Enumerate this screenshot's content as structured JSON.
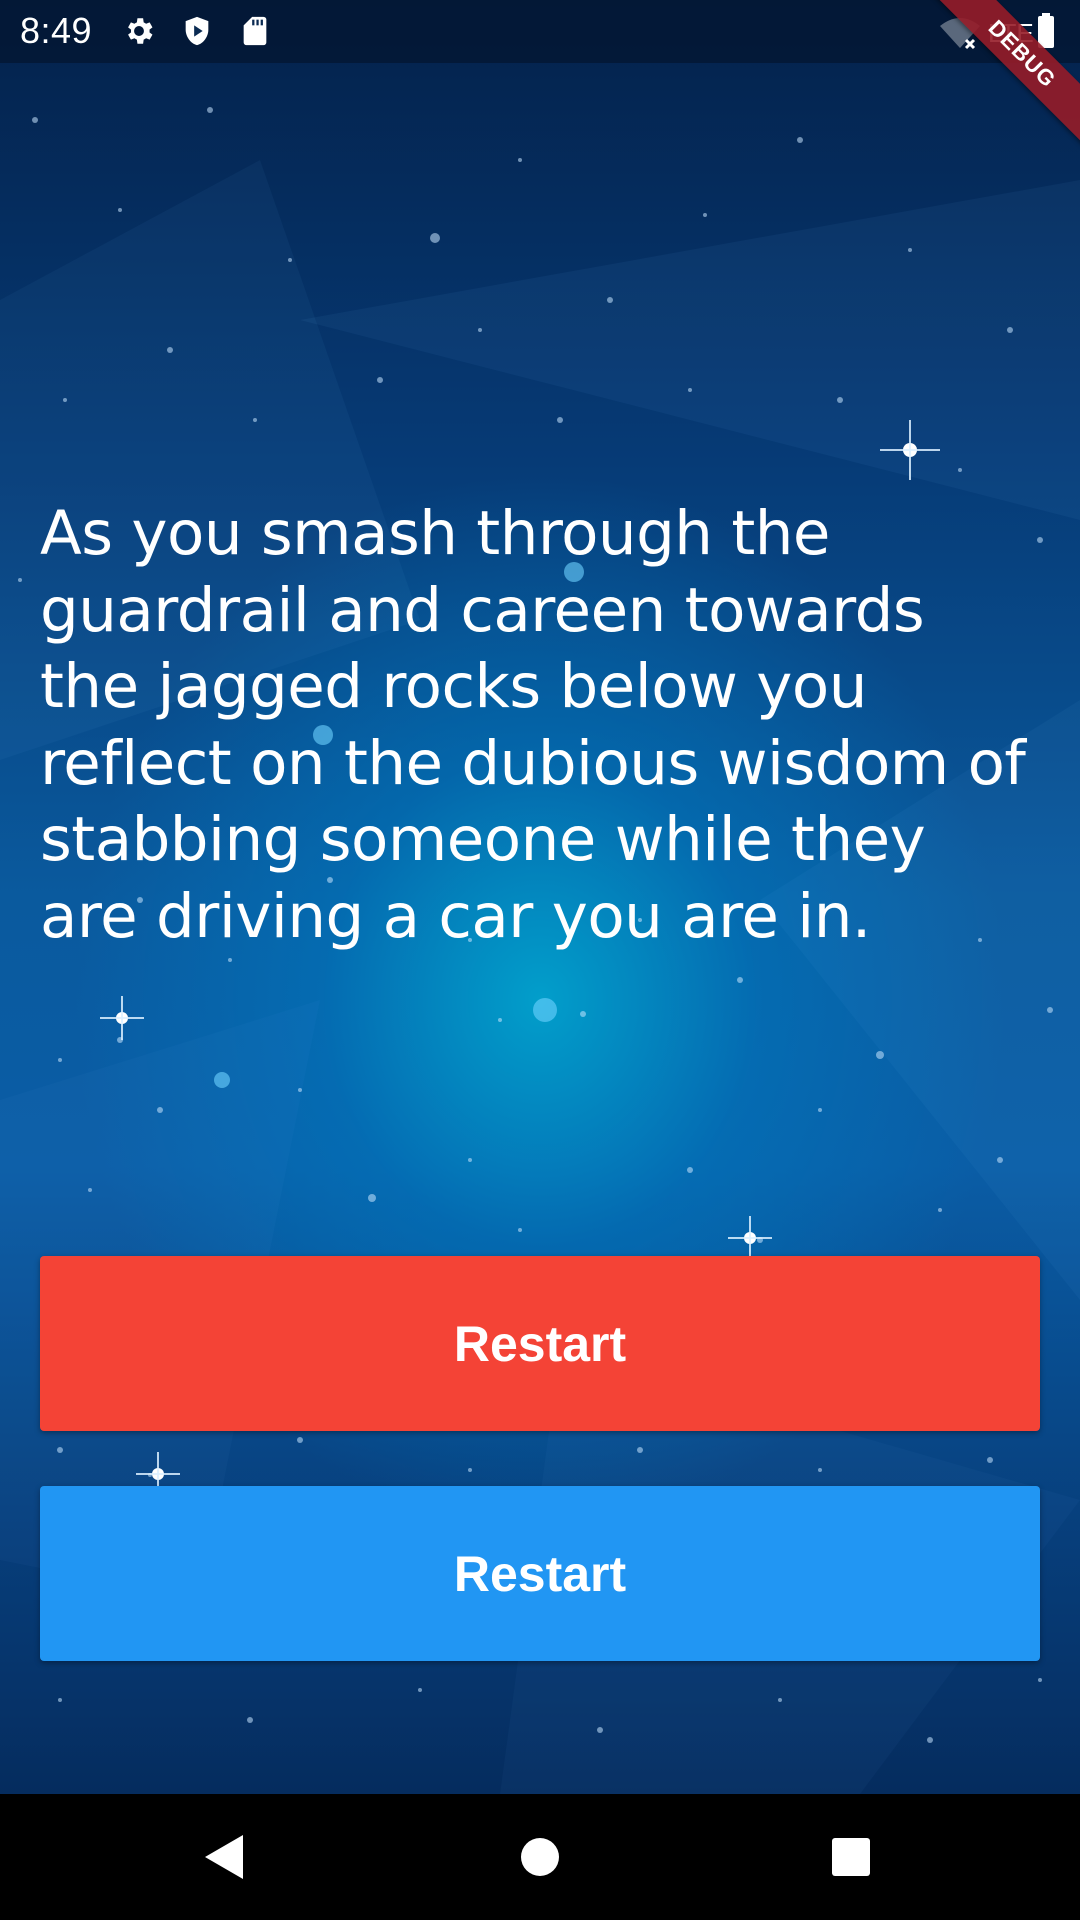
{
  "status_bar": {
    "time": "8:49",
    "icons": [
      "gear-icon",
      "play-protect-icon",
      "sd-card-icon"
    ],
    "right_icons": [
      "wifi-off-icon",
      "signal-lte-icon",
      "battery-icon"
    ],
    "network_label": "LTE"
  },
  "debug_banner": {
    "label": "DEBUG"
  },
  "story": {
    "text": "As you smash through the guardrail and careen towards the jagged rocks below you reflect on the dubious wisdom of stabbing someone while they are driving a car you are in."
  },
  "choices": [
    {
      "label": "Restart",
      "color": "#f44336"
    },
    {
      "label": "Restart",
      "color": "#2196f3"
    }
  ],
  "nav_bar": {
    "buttons": [
      "back-icon",
      "home-icon",
      "recents-icon"
    ]
  }
}
